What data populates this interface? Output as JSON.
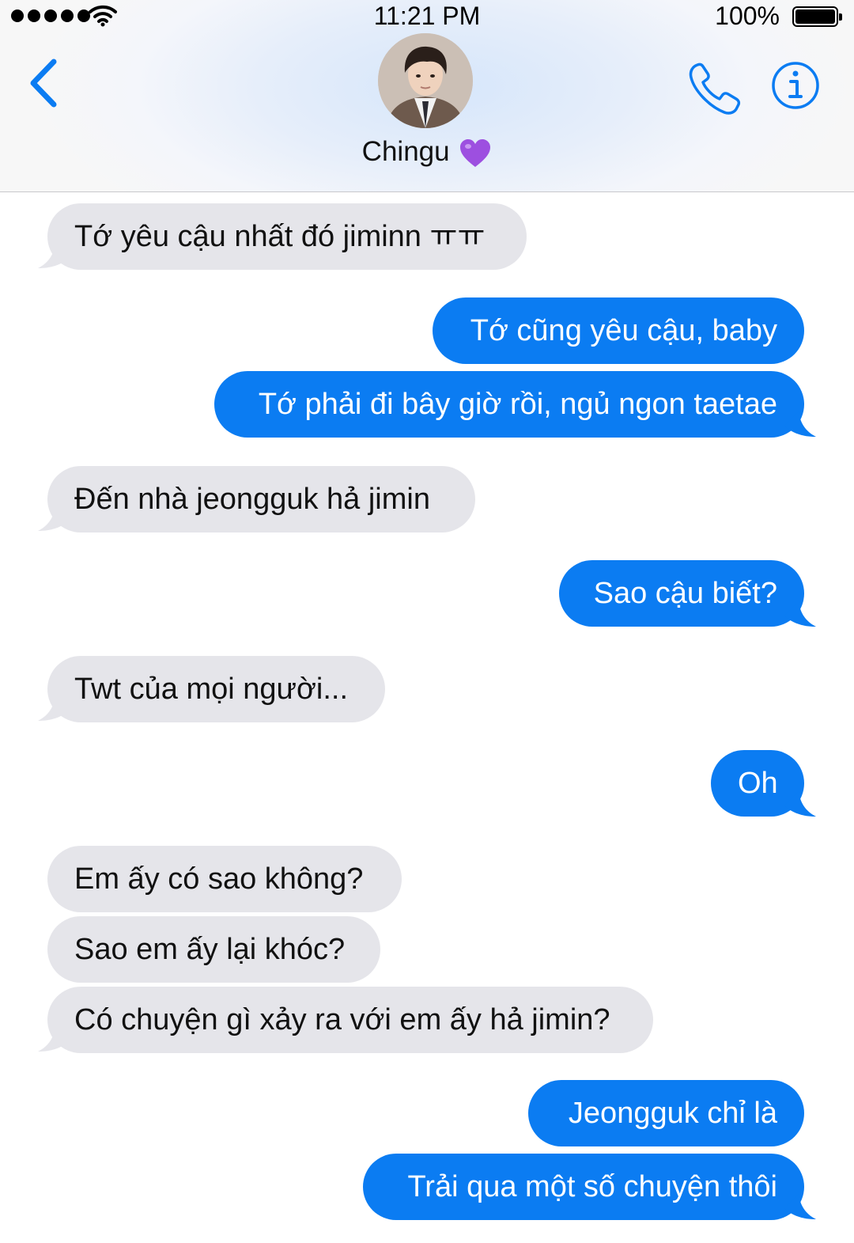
{
  "status_bar": {
    "time": "11:21 PM",
    "battery_percent": "100%",
    "signal_bars": 5,
    "icons": [
      "signal-dots-icon",
      "wifi-icon",
      "battery-icon"
    ]
  },
  "header": {
    "contact_name": "Chingu",
    "contact_emoji": "purple-heart-icon",
    "icons": [
      "back-chevron-icon",
      "phone-icon",
      "info-icon"
    ],
    "accent_color": "#0b7cf2"
  },
  "messages": [
    {
      "side": "incoming",
      "text": "Tớ yêu cậu nhất đó jiminn ㅠㅠ"
    },
    {
      "side": "outgoing",
      "text": "Tớ cũng yêu cậu, baby"
    },
    {
      "side": "outgoing",
      "text": "Tớ phải đi bây giờ rồi, ngủ ngon taetae"
    },
    {
      "side": "incoming",
      "text": "Đến nhà jeongguk hả jimin"
    },
    {
      "side": "outgoing",
      "text": "Sao cậu biết?"
    },
    {
      "side": "incoming",
      "text": "Twt của mọi người..."
    },
    {
      "side": "outgoing",
      "text": "Oh"
    },
    {
      "side": "incoming",
      "text": "Em ấy có sao không?"
    },
    {
      "side": "incoming",
      "text": "Sao em ấy lại khóc?"
    },
    {
      "side": "incoming",
      "text": "Có chuyện gì xảy ra với em ấy hả jimin?"
    },
    {
      "side": "outgoing",
      "text": "Jeongguk chỉ là"
    },
    {
      "side": "outgoing",
      "text": "Trải qua một số chuyện thôi"
    }
  ],
  "colors": {
    "incoming_bubble": "#e5e5ea",
    "outgoing_bubble": "#0b7cf2",
    "outgoing_text": "#ffffff"
  }
}
